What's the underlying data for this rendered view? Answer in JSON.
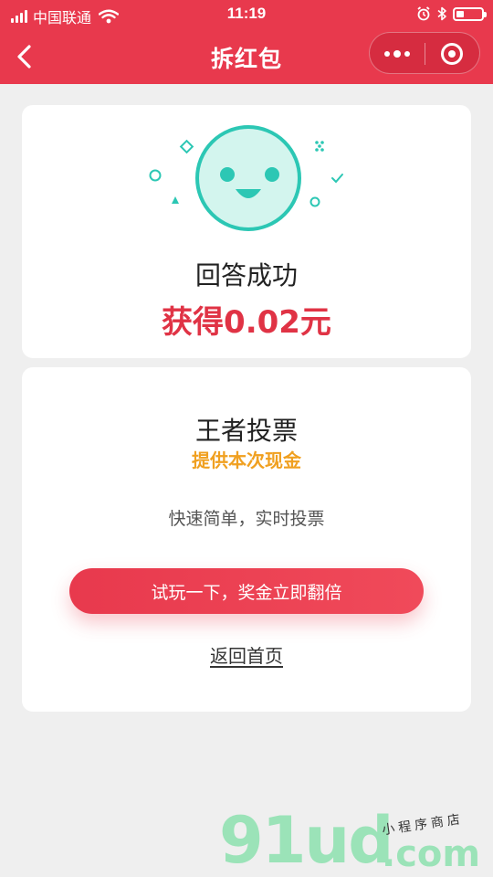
{
  "status_bar": {
    "carrier": "中国联通",
    "time": "11:19"
  },
  "nav": {
    "title": "拆红包",
    "back_icon": "chevron-left-icon",
    "more_icon": "more-dots-icon",
    "close_icon": "target-close-icon"
  },
  "result": {
    "face_icon": "smiley-face-icon",
    "title": "回答成功",
    "reward": "获得0.02元"
  },
  "promo": {
    "title": "王者投票",
    "subtitle": "提供本次现金",
    "description": "快速简单，实时投票",
    "cta_label": "试玩一下，奖金立即翻倍",
    "home_link": "返回首页"
  },
  "watermark": {
    "brand": "91ud",
    "domain": ".com",
    "tagline": "小程序商店"
  },
  "colors": {
    "brand_red": "#e8394d",
    "reward_red": "#e03345",
    "accent_orange": "#f0a020",
    "face_teal": "#2cc7b4"
  }
}
